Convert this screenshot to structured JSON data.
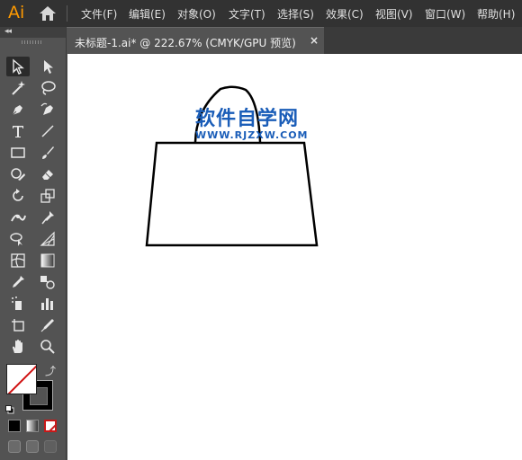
{
  "app": {
    "logo": "Ai"
  },
  "menu": [
    "文件(F)",
    "编辑(E)",
    "对象(O)",
    "文字(T)",
    "选择(S)",
    "效果(C)",
    "视图(V)",
    "窗口(W)",
    "帮助(H)"
  ],
  "toolbar": {
    "collapse_label": "◂◂"
  },
  "document": {
    "tab_label": "未标题-1.ai* @ 222.67% (CMYK/GPU 预览)",
    "close_label": "×"
  },
  "watermark": {
    "title": "软件自学网",
    "url": "WWW.RJZXW.COM"
  },
  "colors": {
    "accent": "#ff9a00",
    "watermark": "#1a5db8",
    "menubar_bg": "#323232",
    "panel_bg": "#535353",
    "canvas_bg": "#ffffff"
  },
  "icons": {
    "tools": [
      "selection-tool",
      "direct-selection-tool",
      "magic-wand-tool",
      "lasso-tool",
      "pen-tool",
      "curvature-tool",
      "type-tool",
      "line-segment-tool",
      "rectangle-tool",
      "paintbrush-tool",
      "shaper-tool",
      "eraser-tool",
      "rotate-tool",
      "scale-tool",
      "width-tool",
      "puppet-warp-tool",
      "shape-builder-tool",
      "perspective-grid-tool",
      "mesh-tool",
      "gradient-tool",
      "eyedropper-tool",
      "blend-tool",
      "symbol-sprayer-tool",
      "column-graph-tool",
      "artboard-tool",
      "slice-tool",
      "hand-tool",
      "zoom-tool"
    ]
  }
}
